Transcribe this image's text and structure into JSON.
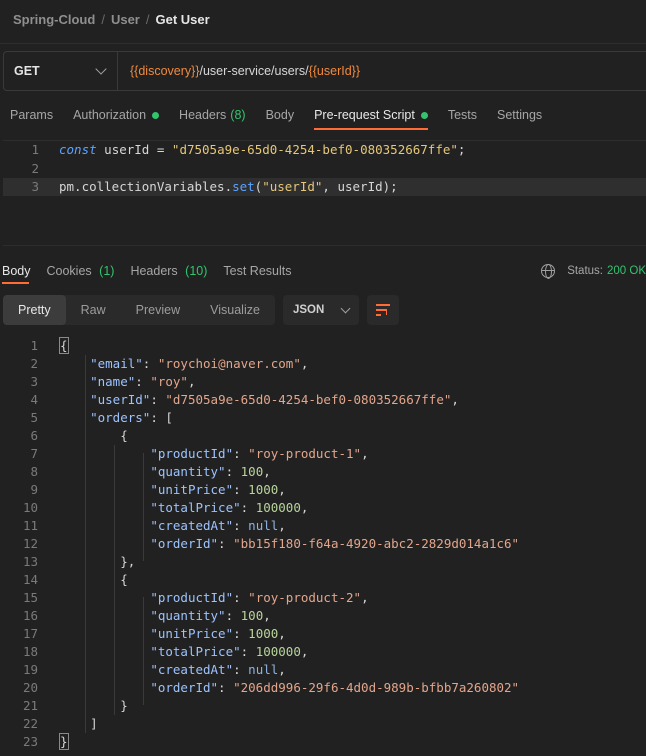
{
  "breadcrumb": {
    "items": [
      "Spring-Cloud",
      "User"
    ],
    "current": "Get User",
    "separator": "/"
  },
  "request": {
    "method": "GET",
    "url_parts": [
      {
        "text": "{{discovery}}",
        "var": true
      },
      {
        "text": "/user-service/users/",
        "var": false
      },
      {
        "text": "{{userId}}",
        "var": true
      }
    ]
  },
  "request_tabs": [
    {
      "label": "Params"
    },
    {
      "label": "Authorization",
      "dot": true
    },
    {
      "label": "Headers",
      "count": "(8)"
    },
    {
      "label": "Body"
    },
    {
      "label": "Pre-request Script",
      "dot": true,
      "active": true
    },
    {
      "label": "Tests"
    },
    {
      "label": "Settings"
    }
  ],
  "script": {
    "lines": [
      {
        "n": "1",
        "tokens": [
          [
            "kw",
            "const"
          ],
          [
            "plain",
            " userId "
          ],
          [
            "plain",
            "= "
          ],
          [
            "str",
            "\"d7505a9e-65d0-4254-bef0-080352667ffe\""
          ],
          [
            "plain",
            ";"
          ]
        ]
      },
      {
        "n": "2",
        "tokens": []
      },
      {
        "n": "3",
        "highlight": true,
        "tokens": [
          [
            "plain",
            "pm.collectionVariables."
          ],
          [
            "fn",
            "set"
          ],
          [
            "plain",
            "("
          ],
          [
            "str",
            "\"userId\""
          ],
          [
            "plain",
            ", userId);"
          ]
        ]
      }
    ]
  },
  "response_tabs": [
    {
      "label": "Body",
      "active": true
    },
    {
      "label": "Cookies",
      "count": "(1)"
    },
    {
      "label": "Headers",
      "count": "(10)"
    },
    {
      "label": "Test Results"
    }
  ],
  "status": {
    "label": "Status:",
    "value": "200 OK"
  },
  "view_modes": [
    "Pretty",
    "Raw",
    "Preview",
    "Visualize"
  ],
  "active_view": "Pretty",
  "format": "JSON",
  "response_lines": [
    {
      "n": "1",
      "indent": 0,
      "tokens": [
        [
          "box",
          "{"
        ]
      ]
    },
    {
      "n": "2",
      "indent": 1,
      "tokens": [
        [
          "key",
          "\"email\""
        ],
        [
          "punct",
          ": "
        ],
        [
          "val-str",
          "\"roychoi@naver.com\""
        ],
        [
          "punct",
          ","
        ]
      ]
    },
    {
      "n": "3",
      "indent": 1,
      "tokens": [
        [
          "key",
          "\"name\""
        ],
        [
          "punct",
          ": "
        ],
        [
          "val-str",
          "\"roy\""
        ],
        [
          "punct",
          ","
        ]
      ]
    },
    {
      "n": "4",
      "indent": 1,
      "tokens": [
        [
          "key",
          "\"userId\""
        ],
        [
          "punct",
          ": "
        ],
        [
          "val-str",
          "\"d7505a9e-65d0-4254-bef0-080352667ffe\""
        ],
        [
          "punct",
          ","
        ]
      ]
    },
    {
      "n": "5",
      "indent": 1,
      "tokens": [
        [
          "key",
          "\"orders\""
        ],
        [
          "punct",
          ": ["
        ]
      ]
    },
    {
      "n": "6",
      "indent": 2,
      "tokens": [
        [
          "punct",
          "{"
        ]
      ]
    },
    {
      "n": "7",
      "indent": 3,
      "tokens": [
        [
          "key",
          "\"productId\""
        ],
        [
          "punct",
          ": "
        ],
        [
          "val-str",
          "\"roy-product-1\""
        ],
        [
          "punct",
          ","
        ]
      ]
    },
    {
      "n": "8",
      "indent": 3,
      "tokens": [
        [
          "key",
          "\"quantity\""
        ],
        [
          "punct",
          ": "
        ],
        [
          "val-num",
          "100"
        ],
        [
          "punct",
          ","
        ]
      ]
    },
    {
      "n": "9",
      "indent": 3,
      "tokens": [
        [
          "key",
          "\"unitPrice\""
        ],
        [
          "punct",
          ": "
        ],
        [
          "val-num",
          "1000"
        ],
        [
          "punct",
          ","
        ]
      ]
    },
    {
      "n": "10",
      "indent": 3,
      "tokens": [
        [
          "key",
          "\"totalPrice\""
        ],
        [
          "punct",
          ": "
        ],
        [
          "val-num",
          "100000"
        ],
        [
          "punct",
          ","
        ]
      ]
    },
    {
      "n": "11",
      "indent": 3,
      "tokens": [
        [
          "key",
          "\"createdAt\""
        ],
        [
          "punct",
          ": "
        ],
        [
          "val-null",
          "null"
        ],
        [
          "punct",
          ","
        ]
      ]
    },
    {
      "n": "12",
      "indent": 3,
      "tokens": [
        [
          "key",
          "\"orderId\""
        ],
        [
          "punct",
          ": "
        ],
        [
          "val-str",
          "\"bb15f180-f64a-4920-abc2-2829d014a1c6\""
        ]
      ]
    },
    {
      "n": "13",
      "indent": 2,
      "tokens": [
        [
          "punct",
          "},"
        ]
      ]
    },
    {
      "n": "14",
      "indent": 2,
      "tokens": [
        [
          "punct",
          "{"
        ]
      ]
    },
    {
      "n": "15",
      "indent": 3,
      "tokens": [
        [
          "key",
          "\"productId\""
        ],
        [
          "punct",
          ": "
        ],
        [
          "val-str",
          "\"roy-product-2\""
        ],
        [
          "punct",
          ","
        ]
      ]
    },
    {
      "n": "16",
      "indent": 3,
      "tokens": [
        [
          "key",
          "\"quantity\""
        ],
        [
          "punct",
          ": "
        ],
        [
          "val-num",
          "100"
        ],
        [
          "punct",
          ","
        ]
      ]
    },
    {
      "n": "17",
      "indent": 3,
      "tokens": [
        [
          "key",
          "\"unitPrice\""
        ],
        [
          "punct",
          ": "
        ],
        [
          "val-num",
          "1000"
        ],
        [
          "punct",
          ","
        ]
      ]
    },
    {
      "n": "18",
      "indent": 3,
      "tokens": [
        [
          "key",
          "\"totalPrice\""
        ],
        [
          "punct",
          ": "
        ],
        [
          "val-num",
          "100000"
        ],
        [
          "punct",
          ","
        ]
      ]
    },
    {
      "n": "19",
      "indent": 3,
      "tokens": [
        [
          "key",
          "\"createdAt\""
        ],
        [
          "punct",
          ": "
        ],
        [
          "val-null",
          "null"
        ],
        [
          "punct",
          ","
        ]
      ]
    },
    {
      "n": "20",
      "indent": 3,
      "tokens": [
        [
          "key",
          "\"orderId\""
        ],
        [
          "punct",
          ": "
        ],
        [
          "val-str",
          "\"206dd996-29f6-4d0d-989b-bfbb7a260802\""
        ]
      ]
    },
    {
      "n": "21",
      "indent": 2,
      "tokens": [
        [
          "punct",
          "}"
        ]
      ]
    },
    {
      "n": "22",
      "indent": 1,
      "tokens": [
        [
          "punct",
          "]"
        ]
      ]
    },
    {
      "n": "23",
      "indent": 0,
      "tokens": [
        [
          "box",
          "}"
        ]
      ]
    }
  ],
  "colors": {
    "accent": "#ff6c37",
    "success": "#33c46e",
    "variable": "#f08a3e"
  },
  "icons": {
    "method_dropdown": "chevron-down-icon",
    "globe": "globe-icon",
    "wrap": "wrap-lines-icon"
  }
}
